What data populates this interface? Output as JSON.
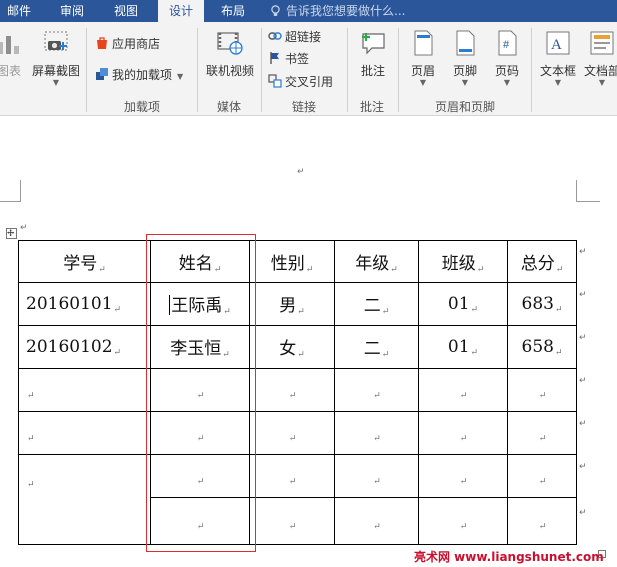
{
  "tabs": [
    "邮件",
    "审阅",
    "视图",
    "设计",
    "布局"
  ],
  "active_tab": "设计",
  "tell_me": {
    "placeholder": "告诉我您想要做什么..."
  },
  "ribbon": {
    "partial_left_label": "图表",
    "screenshot_label": "屏幕截图",
    "app_store_label": "应用商店",
    "my_addins_label": "我的加载项",
    "online_video_label": "联机视频",
    "hyperlink_label": "超链接",
    "bookmark_label": "书签",
    "cross_reference_label": "交叉引用",
    "comment_label": "批注",
    "header_label": "页眉",
    "footer_label": "页脚",
    "page_number_label": "页码",
    "textbox_label": "文本框",
    "doc_parts_label": "文档部",
    "groups": {
      "addins": "加载项",
      "media": "媒体",
      "links": "链接",
      "comments": "批注",
      "header_footer": "页眉和页脚"
    }
  },
  "table": {
    "headers": [
      "学号",
      "姓名",
      "性别",
      "年级",
      "班级",
      "总分"
    ],
    "rows": [
      [
        "20160101",
        "王际禹",
        "男",
        "二",
        "01",
        "683"
      ],
      [
        "20160102",
        "李玉恒",
        "女",
        "二",
        "01",
        "658"
      ]
    ]
  },
  "marks": {
    "paragraph": "↵"
  },
  "watermark": "亮术网 www.liangshunet.com",
  "colors": {
    "accent": "#2b579a",
    "highlight_box": "#e02c2c",
    "watermark": "#c8102e"
  }
}
